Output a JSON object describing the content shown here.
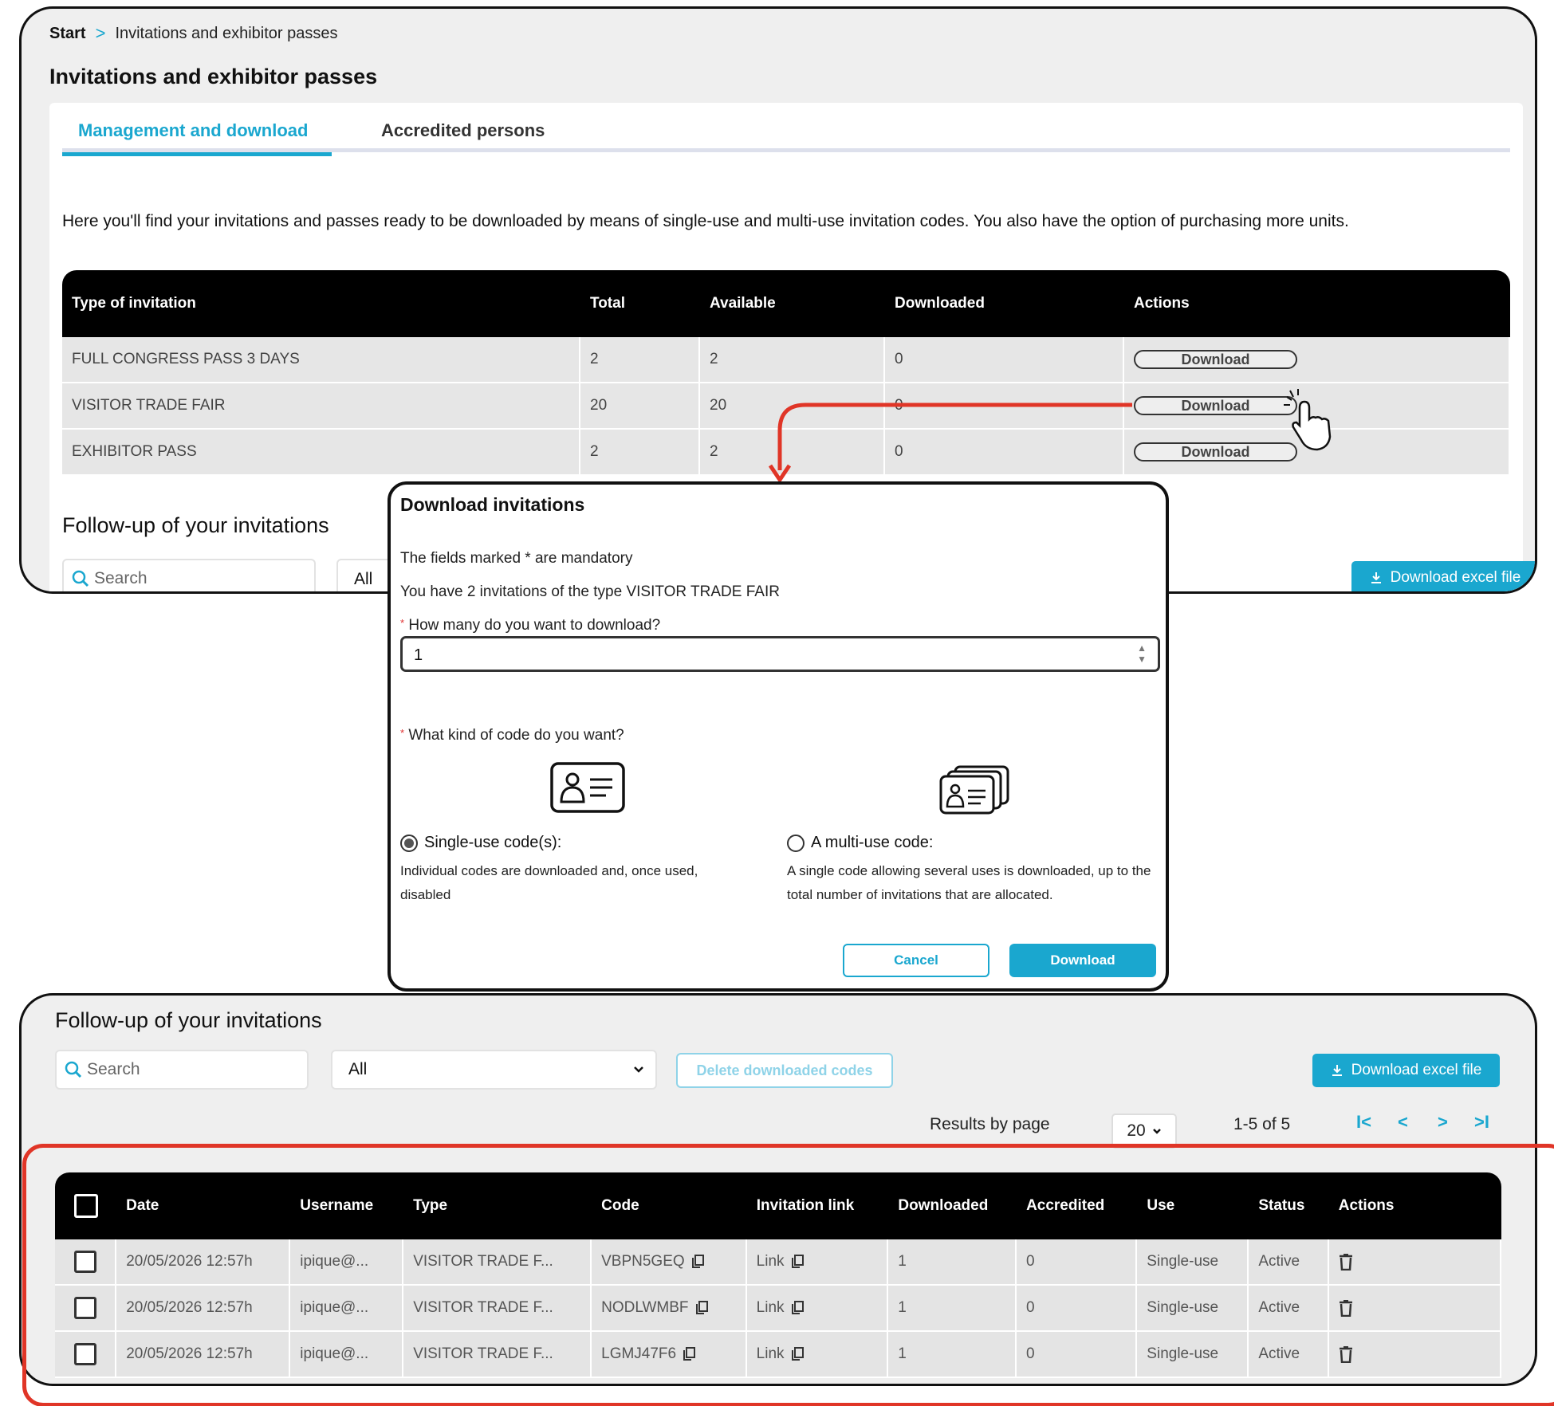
{
  "breadcrumb": {
    "start": "Start",
    "separator": ">",
    "current": "Invitations and exhibitor passes"
  },
  "page_title": "Invitations and exhibitor passes",
  "tabs": [
    {
      "label": "Management and download",
      "active": true
    },
    {
      "label": "Accredited persons",
      "active": false
    }
  ],
  "intro": "Here you'll find your invitations and passes ready to be downloaded by means of single-use and multi-use invitation codes. You also have the option of purchasing more units.",
  "invitation_table": {
    "headers": [
      "Type of invitation",
      "Total",
      "Available",
      "Downloaded",
      "Actions"
    ],
    "rows": [
      {
        "type": "FULL CONGRESS PASS 3 DAYS",
        "total": "2",
        "available": "2",
        "downloaded": "0",
        "action": "Download"
      },
      {
        "type": "VISITOR TRADE FAIR",
        "total": "20",
        "available": "20",
        "downloaded": "0",
        "action": "Download"
      },
      {
        "type": "EXHIBITOR PASS",
        "total": "2",
        "available": "2",
        "downloaded": "0",
        "action": "Download"
      }
    ]
  },
  "followup_top": {
    "title": "Follow-up of your invitations",
    "search_placeholder": "Search",
    "filter_value": "All",
    "excel_button": "Download excel file"
  },
  "dialog": {
    "title": "Download invitations",
    "mandatory_note": "The fields marked * are mandatory",
    "have_text": "You have 2 invitations of the type",
    "type_name": "VISITOR TRADE FAIR",
    "required_mark": "*",
    "qty_label": "How many do you want to download?",
    "qty_value": "1",
    "code_label": "What kind of code do you want?",
    "options": [
      {
        "label": "Single-use code(s):",
        "selected": true,
        "description": "Individual codes are downloaded and, once used, disabled"
      },
      {
        "label": "A multi-use code:",
        "selected": false,
        "description": "A single code allowing several uses is downloaded, up to the total number of invitations that are allocated."
      }
    ],
    "cancel_label": "Cancel",
    "download_label": "Download"
  },
  "followup": {
    "title": "Follow-up of your invitations",
    "search_placeholder": "Search",
    "filter_value": "All",
    "delete_button": "Delete downloaded codes",
    "excel_button": "Download excel file",
    "results_label": "Results by page",
    "per_page": "20",
    "range": "1-5 of 5",
    "nav": [
      "I<",
      "<",
      ">",
      ">I"
    ]
  },
  "codes_table": {
    "headers": [
      "Date",
      "Username",
      "Type",
      "Code",
      "Invitation link",
      "Downloaded",
      "Accredited",
      "Use",
      "Status",
      "Actions"
    ],
    "rows": [
      {
        "date": "20/05/2026 12:57h",
        "username": "ipique@...",
        "type": "VISITOR TRADE F...",
        "code": "VBPN5GEQ",
        "link": "Link",
        "downloaded": "1",
        "accredited": "0",
        "use": "Single-use",
        "status": "Active"
      },
      {
        "date": "20/05/2026 12:57h",
        "username": "ipique@...",
        "type": "VISITOR TRADE F...",
        "code": "NODLWMBF",
        "link": "Link",
        "downloaded": "1",
        "accredited": "0",
        "use": "Single-use",
        "status": "Active"
      },
      {
        "date": "20/05/2026 12:57h",
        "username": "ipique@...",
        "type": "VISITOR TRADE F...",
        "code": "LGMJ47F6",
        "link": "Link",
        "downloaded": "1",
        "accredited": "0",
        "use": "Single-use",
        "status": "Active"
      }
    ]
  },
  "icons": {
    "search": "search-icon",
    "download": "download-icon",
    "copy": "copy-icon",
    "trash": "trash-icon",
    "hand_cursor": "hand-cursor-icon",
    "single_code": "id-card-icon",
    "multi_code": "id-card-stack-icon"
  },
  "colors": {
    "accent": "#1aa7cf",
    "highlight": "#e03527",
    "header_bg": "#000000",
    "row_bg": "#e4e4e4"
  }
}
